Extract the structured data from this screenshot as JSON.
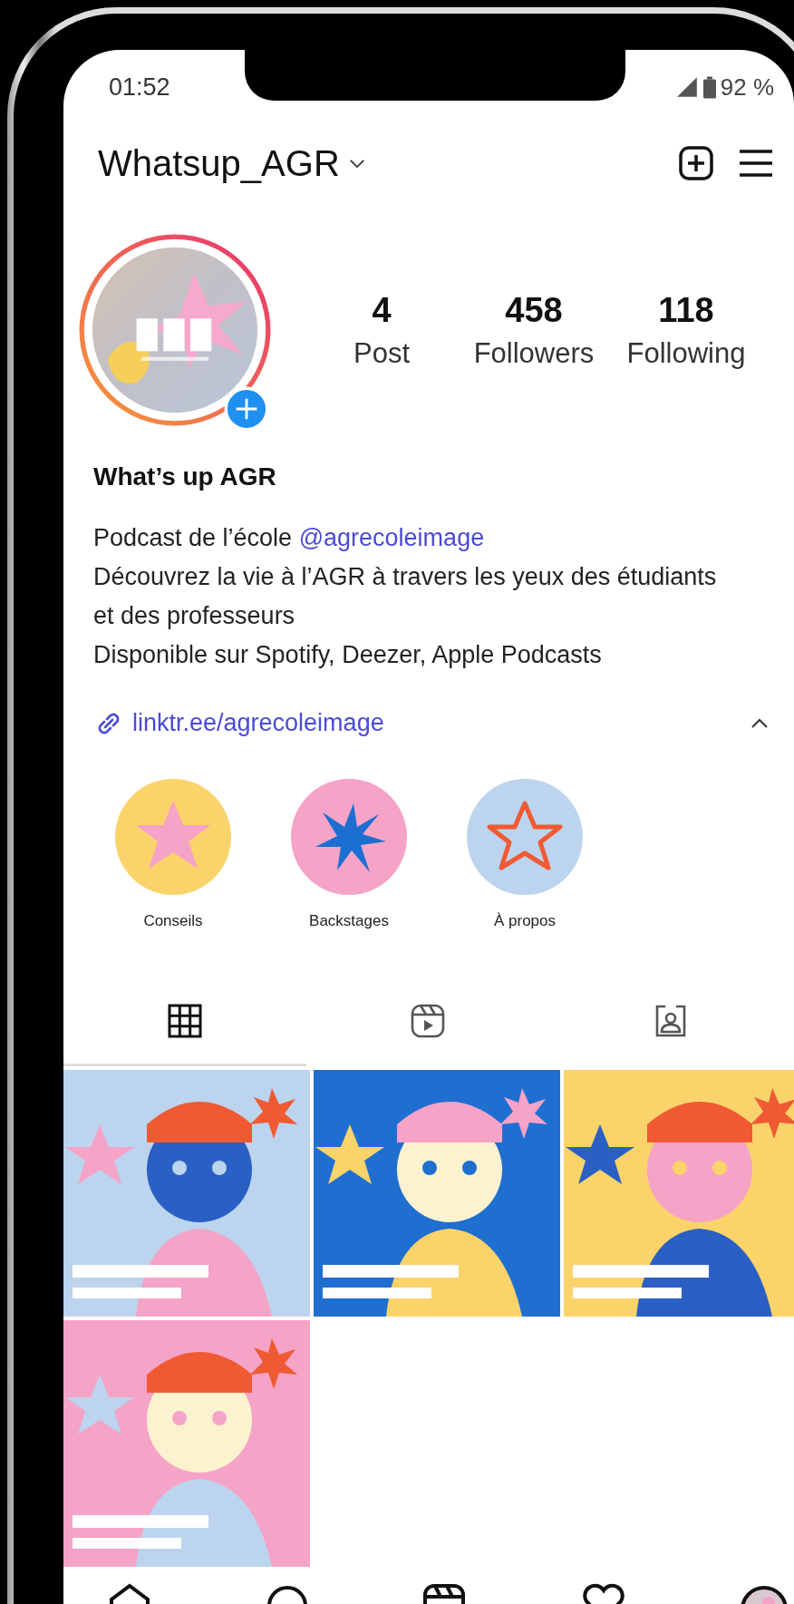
{
  "status_bar": {
    "time": "01:52",
    "battery": "92 %"
  },
  "header": {
    "username": "Whatsup_AGR"
  },
  "profile": {
    "stats": [
      {
        "value": "4",
        "label": "Post"
      },
      {
        "value": "458",
        "label": "Followers"
      },
      {
        "value": "118",
        "label": "Following"
      }
    ],
    "name": "What’s up AGR",
    "bio": [
      {
        "text": "Podcast de l’école ",
        "mention": "@agrecoleimage"
      },
      {
        "text": "Découvrez la vie à l’AGR à travers les yeux des étudiants et des professeurs"
      },
      {
        "text": "Disponible sur Spotify, Deezer, Apple Podcasts"
      }
    ],
    "link": "linktr.ee/agrecoleimage"
  },
  "highlights": [
    {
      "label": "Conseils",
      "kind": "star",
      "color": "#fbd36b"
    },
    {
      "label": "Backstages",
      "kind": "burst",
      "color": "#f5a3c7"
    },
    {
      "label": "À propos",
      "kind": "outline-star",
      "color": "#bcd4ee"
    }
  ],
  "tabs": [
    {
      "kind": "grid",
      "selected": true
    },
    {
      "kind": "reels",
      "selected": false
    },
    {
      "kind": "tagged",
      "selected": false
    }
  ]
}
